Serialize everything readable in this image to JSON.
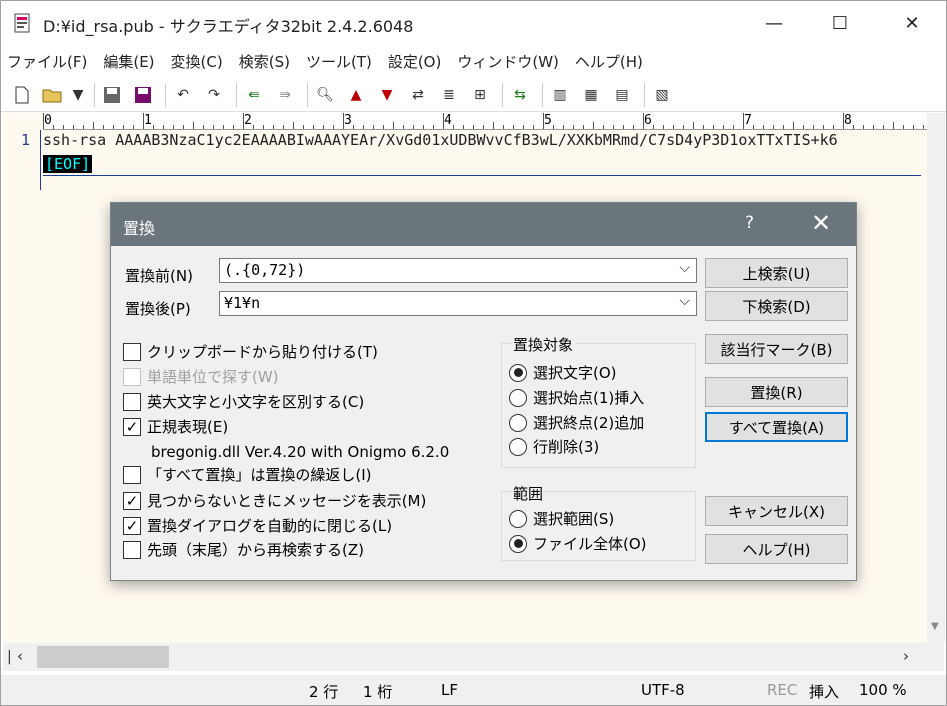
{
  "window": {
    "title": "D:¥id_rsa.pub - サクラエディタ32bit 2.4.2.6048",
    "minimize": "—",
    "maximize": "☐",
    "close": "✕"
  },
  "menu": [
    "ファイル(F)",
    "編集(E)",
    "変換(C)",
    "検索(S)",
    "ツール(T)",
    "設定(O)",
    "ウィンドウ(W)",
    "ヘルプ(H)"
  ],
  "toolbar": {
    "icons": [
      "new-file-icon",
      "open-file-icon",
      "open-dropdown-icon",
      "save-icon",
      "save-all-icon",
      "undo-icon",
      "redo-icon",
      "jump-back-icon",
      "jump-forward-icon",
      "search-icon",
      "search-prev-icon",
      "search-next-icon",
      "replace-icon",
      "grep-icon",
      "grep-replace-icon",
      "bookmark-icon",
      "outline-icon",
      "compare-icon",
      "function-list-icon",
      "settings-icon"
    ]
  },
  "ruler": {
    "numbers": [
      "0",
      "1",
      "2",
      "3",
      "4",
      "5",
      "6",
      "7",
      "8"
    ]
  },
  "editor": {
    "line_number": "1",
    "line1": "ssh-rsa AAAAB3NzaC1yc2EAAAABIwAAAYEAr/XvGd01xUDBWvvCfB3wL/XXKbMRmd/C7sD4yP3D1oxTTxTIS+k6",
    "eof": "[EOF]"
  },
  "status": {
    "line": "2 行",
    "col": "1 桁",
    "eol": "LF",
    "encoding": "UTF-8",
    "rec": "REC",
    "mode": "挿入",
    "zoom": "100 %"
  },
  "dialog": {
    "title": "置換",
    "help_icon": "?",
    "close_icon": "✕",
    "find_label": "置換前(N)",
    "find_value": "(.{0,72})",
    "replace_label": "置換後(P)",
    "replace_value": "¥1¥n",
    "buttons": {
      "search_up": "上検索(U)",
      "search_down": "下検索(D)",
      "mark_lines": "該当行マーク(B)",
      "replace": "置換(R)",
      "replace_all": "すべて置換(A)",
      "cancel": "キャンセル(X)",
      "help": "ヘルプ(H)"
    },
    "options": {
      "paste_clipboard": "クリップボードから貼り付ける(T)",
      "whole_word": "単語単位で探す(W)",
      "case_sensitive": "英大文字と小文字を区別する(C)",
      "regex": "正規表現(E)",
      "regex_lib": "bregonig.dll Ver.4.20 with Onigmo 6.2.0",
      "repeat_replace": "「すべて置換」は置換の繰返し(I)",
      "show_not_found": "見つからないときにメッセージを表示(M)",
      "auto_close": "置換ダイアログを自動的に閉じる(L)",
      "wrap_search": "先頭（末尾）から再検索する(Z)"
    },
    "target": {
      "title": "置換対象",
      "selected": "選択文字(O)",
      "insert_start": "選択始点(1)挿入",
      "append_end": "選択終点(2)追加",
      "delete_line": "行削除(3)"
    },
    "range": {
      "title": "範囲",
      "selection": "選択範囲(S)",
      "whole_file": "ファイル全体(O)"
    }
  }
}
